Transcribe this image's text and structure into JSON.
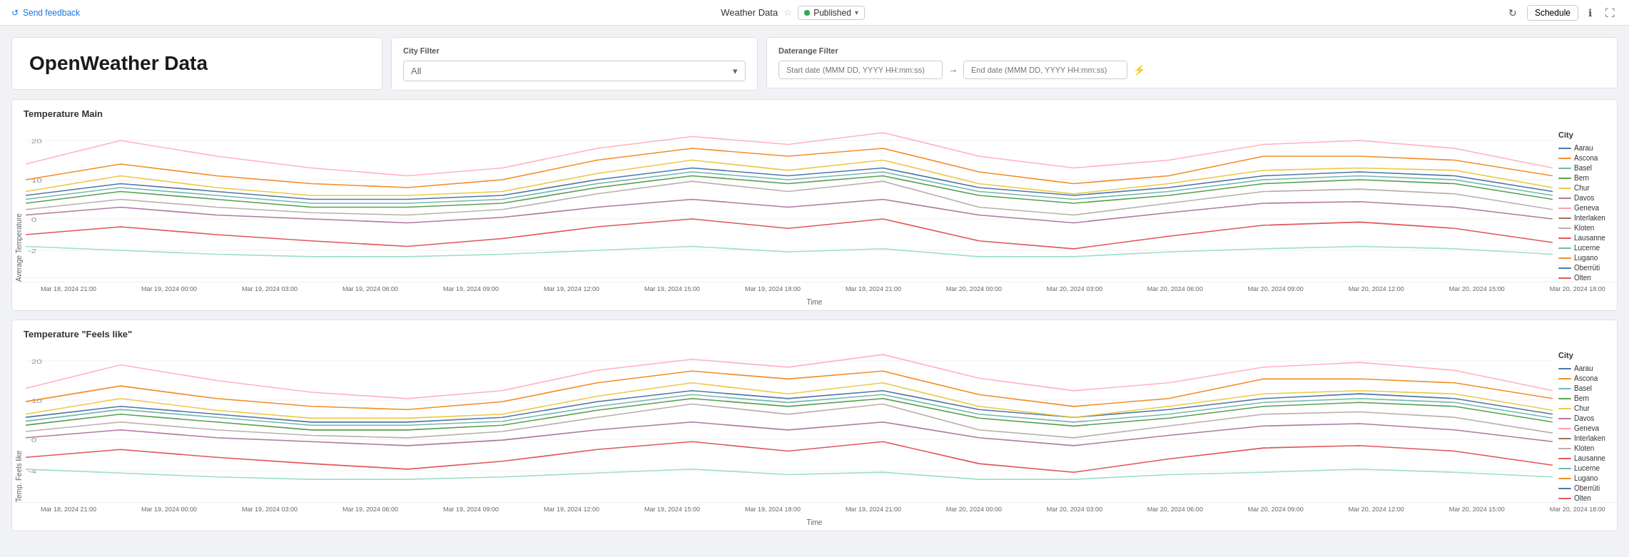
{
  "topBar": {
    "feedback": "Send feedback",
    "title": "Weather Data",
    "status": "Published",
    "scheduleLabel": "Schedule"
  },
  "page": {
    "title": "OpenWeather Data"
  },
  "cityFilter": {
    "label": "City Filter",
    "value": "All",
    "placeholder": "All"
  },
  "daterangeFilter": {
    "label": "Daterange Filter",
    "startPlaceholder": "Start date (MMM DD, YYYY HH:mm:ss)",
    "endPlaceholder": "End date (MMM DD, YYYY HH:mm:ss)"
  },
  "chart1": {
    "title": "Temperature Main",
    "yLabel": "Average Temperature",
    "xLabel": "Time",
    "legendTitle": "City"
  },
  "chart2": {
    "title": "Temperature \"Feels like\"",
    "yLabel": "Temp. Feels like",
    "xLabel": "Time",
    "legendTitle": "City"
  },
  "legend": {
    "items": [
      {
        "name": "Aarau",
        "color": "#4e79a7"
      },
      {
        "name": "Ascona",
        "color": "#f28e2b"
      },
      {
        "name": "Basel",
        "color": "#76b7b2"
      },
      {
        "name": "Bern",
        "color": "#59a14f"
      },
      {
        "name": "Chur",
        "color": "#edc948"
      },
      {
        "name": "Davos",
        "color": "#b07aa1"
      },
      {
        "name": "Geneva",
        "color": "#ff9da7"
      },
      {
        "name": "Interlaken",
        "color": "#9c755f"
      },
      {
        "name": "Kloten",
        "color": "#bab0ac"
      },
      {
        "name": "Lausanne",
        "color": "#e15759"
      },
      {
        "name": "Lucerne",
        "color": "#76b7b2"
      },
      {
        "name": "Lugano",
        "color": "#f28e2b"
      },
      {
        "name": "Oberrüti",
        "color": "#4e79a7"
      },
      {
        "name": "Olten",
        "color": "#e15759"
      }
    ]
  },
  "xAxisLabels": [
    "Mar 18, 2024 21:00",
    "Mar 19, 2024 00:00",
    "Mar 19, 2024 03:00",
    "Mar 19, 2024 06:00",
    "Mar 19, 2024 09:00",
    "Mar 19, 2024 12:00",
    "Mar 19, 2024 15:00",
    "Mar 19, 2024 18:00",
    "Mar 19, 2024 21:00",
    "Mar 20, 2024 00:00",
    "Mar 20, 2024 03:00",
    "Mar 20, 2024 06:00",
    "Mar 20, 2024 09:00",
    "Mar 20, 2024 12:00",
    "Mar 20, 2024 15:00",
    "Mar 20, 2024 18:00"
  ]
}
